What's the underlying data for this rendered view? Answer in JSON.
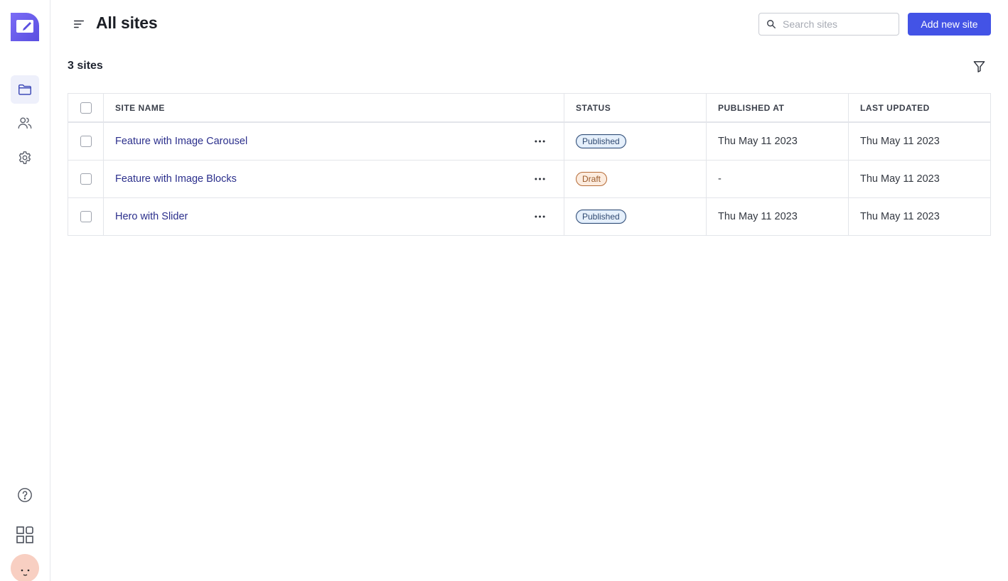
{
  "app": {
    "brand_color": "#6a5cf0",
    "accent_color": "#4353e6"
  },
  "sidebar": {
    "logo_icon": "pencil-note-icon",
    "items": [
      {
        "icon": "folder-icon",
        "active": true
      },
      {
        "icon": "users-icon",
        "active": false
      },
      {
        "icon": "gear-icon",
        "active": false
      }
    ],
    "bottom": [
      {
        "icon": "help-icon"
      },
      {
        "icon": "apps-grid-icon"
      },
      {
        "icon": "avatar"
      }
    ]
  },
  "header": {
    "title": "All sites",
    "search_placeholder": "Search sites",
    "add_button_label": "Add new site"
  },
  "summary": {
    "count_label": "3 sites"
  },
  "table": {
    "columns": [
      "SITE NAME",
      "STATUS",
      "PUBLISHED AT",
      "LAST UPDATED"
    ],
    "rows": [
      {
        "name": "Feature with Image Carousel",
        "status": "Published",
        "status_type": "published",
        "published_at": "Thu May 11 2023",
        "last_updated": "Thu May 11 2023"
      },
      {
        "name": "Feature with Image Blocks",
        "status": "Draft",
        "status_type": "draft",
        "published_at": "-",
        "last_updated": "Thu May 11 2023"
      },
      {
        "name": "Hero with Slider",
        "status": "Published",
        "status_type": "published",
        "published_at": "Thu May 11 2023",
        "last_updated": "Thu May 11 2023"
      }
    ]
  }
}
